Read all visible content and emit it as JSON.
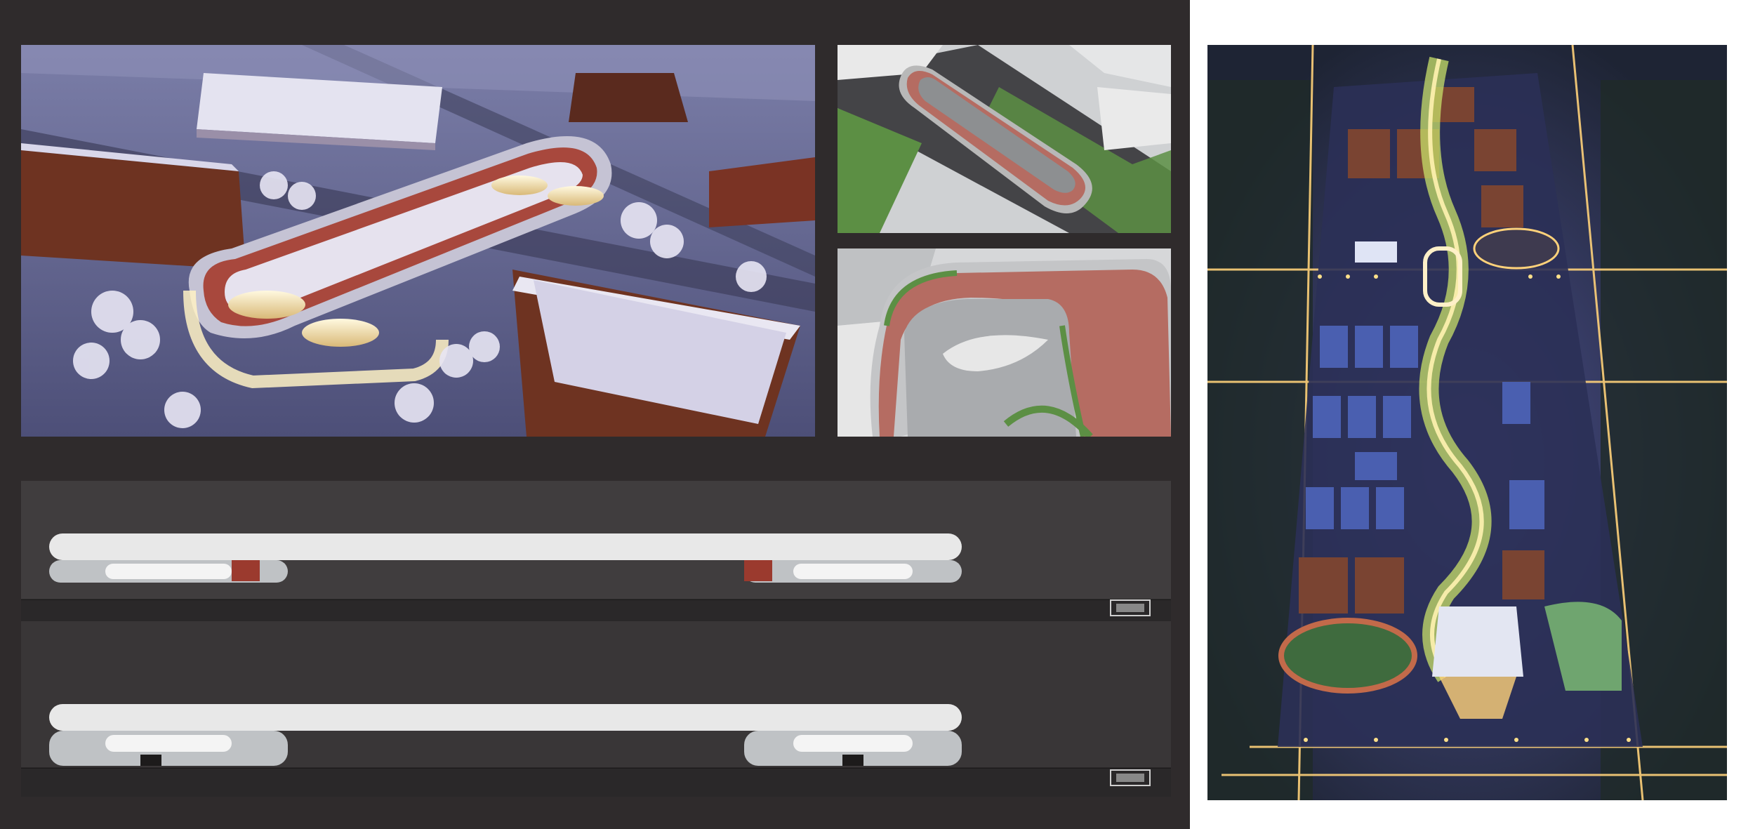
{
  "board": {
    "background": "#2f2b2c",
    "margin_color": "#ffffff"
  },
  "images": {
    "aerial_snow_render": {
      "icon": "snow-campus-skybridge-render",
      "palette": {
        "sky": "#5a5f8a",
        "snow": "#d8d6ea",
        "brick": "#6e3321",
        "track": "#a8483d",
        "glow": "#fff2c4"
      }
    },
    "massing_model_top": {
      "icon": "skybridge-massing-model",
      "palette": {
        "ground": "#cfd1d3",
        "grass": "#5c8f44",
        "road": "#444447",
        "track": "#b56c62"
      }
    },
    "massing_model_bottom": {
      "icon": "skybridge-ramp-model",
      "palette": {
        "ground": "#cfd1d3",
        "grass": "#5c8f44",
        "track": "#b56c62"
      }
    },
    "elevation_drawings": {
      "icon": "skybridge-elevation",
      "palette": {
        "background": "#3b393a",
        "structure": "#e8e8e8",
        "glass": "#bfc2c5",
        "accent": "#9b3a2e"
      }
    },
    "campus_night_masterplan": {
      "icon": "campus-night-aerial",
      "palette": {
        "sky": "#3a3d74",
        "trees": "#1f2b28",
        "road_light": "#ffd27a",
        "roof": "#4a5fb0"
      }
    }
  }
}
